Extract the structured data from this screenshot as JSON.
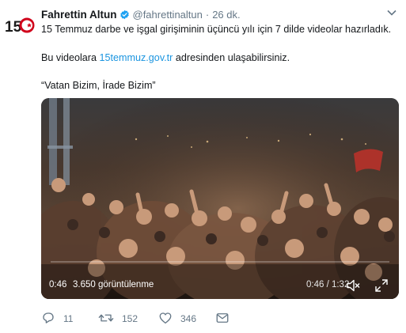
{
  "tweet": {
    "author": {
      "name": "Fahrettin Altun",
      "handle": "@fahrettinaltun",
      "time": "26 dk.",
      "separator": "·"
    },
    "lines": [
      "15 Temmuz darbe ve işgal girişiminin üçüncü yılı için 7 dilde  videolar hazırladık.",
      "adresinden ulaşabilirsiniz.",
      "“Vatan Bizim, İrade Bizim”"
    ],
    "line2_prefix": "Bu videolara ",
    "link": "15temmuz.gov.tr",
    "video": {
      "elapsed": "0:46",
      "views": "3.650 görüntülenme",
      "duration": "0:46 / 1:32",
      "progress": 0.5
    },
    "actions": {
      "replies": "11",
      "retweets": "152",
      "likes": "346"
    },
    "colors": {
      "link": "#1b95e0",
      "verified": "#1da1f2",
      "muted": "#657786"
    },
    "icons": [
      "verified-badge-icon",
      "chevron-down-icon",
      "reply-icon",
      "retweet-icon",
      "heart-icon",
      "direct-message-icon",
      "mute-icon",
      "fullscreen-icon"
    ]
  }
}
